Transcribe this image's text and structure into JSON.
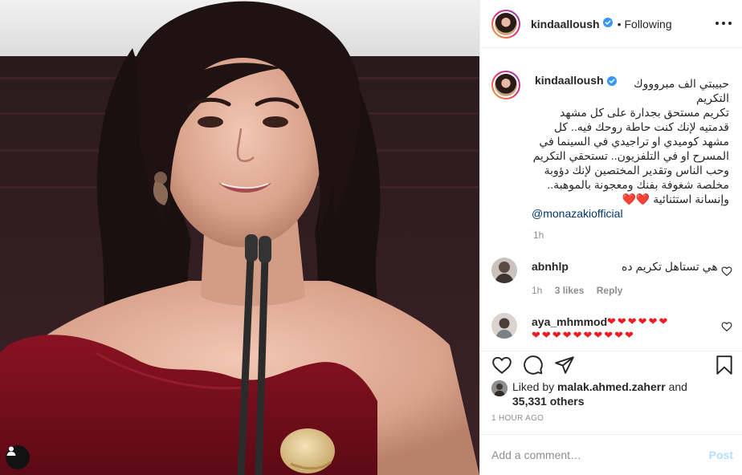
{
  "post": {
    "author": "kindaalloush",
    "follow_status": "Following",
    "separator": "•"
  },
  "caption": {
    "lines": [
      "حبيبتي الف مبروووك",
      "التكريم",
      "تكريم مستحق بجدارة على كل مشهد",
      "قدمتيه لإنك كنت حاطة روحك فيه.. كل",
      "مشهد كوميدي او تراجيدي في السينما في",
      "المسرح او في التلفزيون.. تستحقي التكريم",
      "وحب الناس وتقدير المختصين لإنك دؤوبة",
      "مخلصة شغوفة بفنك ومعجونة بالموهبة..",
      "وإنسانة استثنائية"
    ],
    "hearts": "❤️❤️",
    "mention": "@monazakiofficial",
    "time": "1h"
  },
  "comments": [
    {
      "user": "abnhlp",
      "text": "هي تستاهل تكريم ده",
      "time": "1h",
      "likes": "3 likes",
      "reply": "Reply"
    },
    {
      "user": "aya_mhmmod",
      "hearts_line1": "❤❤❤❤❤❤",
      "hearts_line2": "❤❤❤❤❤❤❤❤❤❤"
    }
  ],
  "likes": {
    "prefix": "Liked by",
    "user": "malak.ahmed.zaherr",
    "and": "and",
    "count": "35,331 others"
  },
  "timestamp": "1 HOUR AGO",
  "add_comment": {
    "placeholder": "Add a comment…",
    "post_label": "Post"
  },
  "colors": {
    "verified": "#3897f0",
    "link": "#00376b",
    "heart": "#ed1c24",
    "post_disabled": "#b2dffc",
    "muted": "#8e8e8e"
  },
  "icons": {
    "like": "heart-icon",
    "comment": "comment-bubble-icon",
    "share": "paper-plane-icon",
    "save": "bookmark-icon",
    "options": "more-options-icon",
    "tagged": "user-tag-icon"
  }
}
